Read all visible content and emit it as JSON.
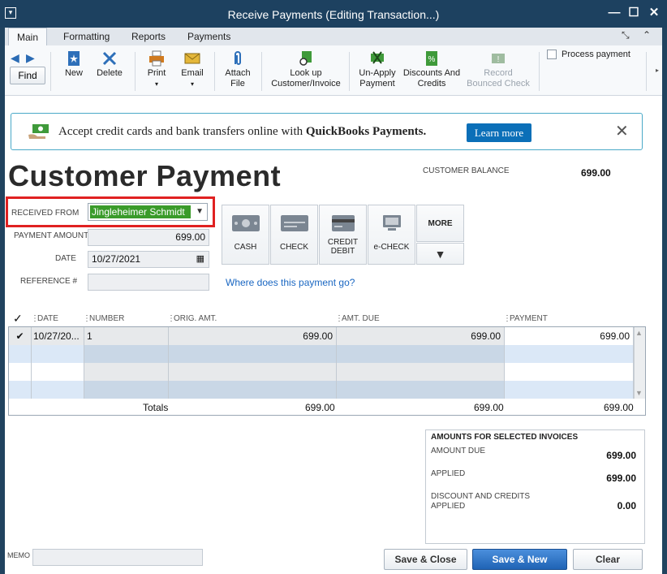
{
  "window": {
    "title": "Receive Payments (Editing Transaction...)",
    "minimize": "—",
    "maximize": "☐",
    "close": "✕"
  },
  "tabs": [
    {
      "label": "Main",
      "active": true
    },
    {
      "label": "Formatting",
      "active": false
    },
    {
      "label": "Reports",
      "active": false
    },
    {
      "label": "Payments",
      "active": false
    }
  ],
  "toolbar": {
    "find": "Find",
    "new": "New",
    "delete": "Delete",
    "print": "Print",
    "email": "Email",
    "attach_file_l1": "Attach",
    "attach_file_l2": "File",
    "lookup_l1": "Look up",
    "lookup_l2": "Customer/Invoice",
    "unapply_l1": "Un-Apply",
    "unapply_l2": "Payment",
    "discounts_l1": "Discounts And",
    "discounts_l2": "Credits",
    "record_l1": "Record",
    "record_l2": "Bounced Check",
    "process_payment": "Process payment"
  },
  "banner": {
    "text": "Accept credit cards and bank transfers online with ",
    "brand": "QuickBooks Payments.",
    "learn_more": "Learn more"
  },
  "form": {
    "page_title": "Customer Payment",
    "customer_balance_label": "CUSTOMER BALANCE",
    "customer_balance": "699.00",
    "received_from_label": "RECEIVED FROM",
    "received_from": "Jingleheimer Schmidt",
    "payment_amount_label": "PAYMENT AMOUNT",
    "payment_amount": "699.00",
    "date_label": "DATE",
    "date": "10/27/2021",
    "reference_label": "REFERENCE #",
    "reference": "",
    "where_link": "Where does this payment go?"
  },
  "payment_methods": {
    "cash": "CASH",
    "check": "CHECK",
    "credit_l1": "CREDIT",
    "credit_l2": "DEBIT",
    "echeck": "e-CHECK",
    "more": "MORE"
  },
  "grid": {
    "columns": [
      "DATE",
      "NUMBER",
      "ORIG. AMT.",
      "AMT. DUE",
      "PAYMENT"
    ],
    "rows": [
      {
        "date": "10/27/20...",
        "number": "1",
        "orig_amt": "699.00",
        "amt_due": "699.00",
        "payment": "699.00"
      }
    ],
    "totals_label": "Totals",
    "totals": {
      "orig_amt": "699.00",
      "amt_due": "699.00",
      "payment": "699.00"
    }
  },
  "amounts": {
    "header": "AMOUNTS FOR SELECTED INVOICES",
    "amount_due_label": "AMOUNT DUE",
    "amount_due": "699.00",
    "applied_label": "APPLIED",
    "applied": "699.00",
    "discount_label_l1": "DISCOUNT AND CREDITS",
    "discount_label_l2": "APPLIED",
    "discount": "0.00"
  },
  "footer": {
    "memo_label": "MEMO",
    "save_close": "Save & Close",
    "save_new": "Save & New",
    "clear": "Clear"
  }
}
